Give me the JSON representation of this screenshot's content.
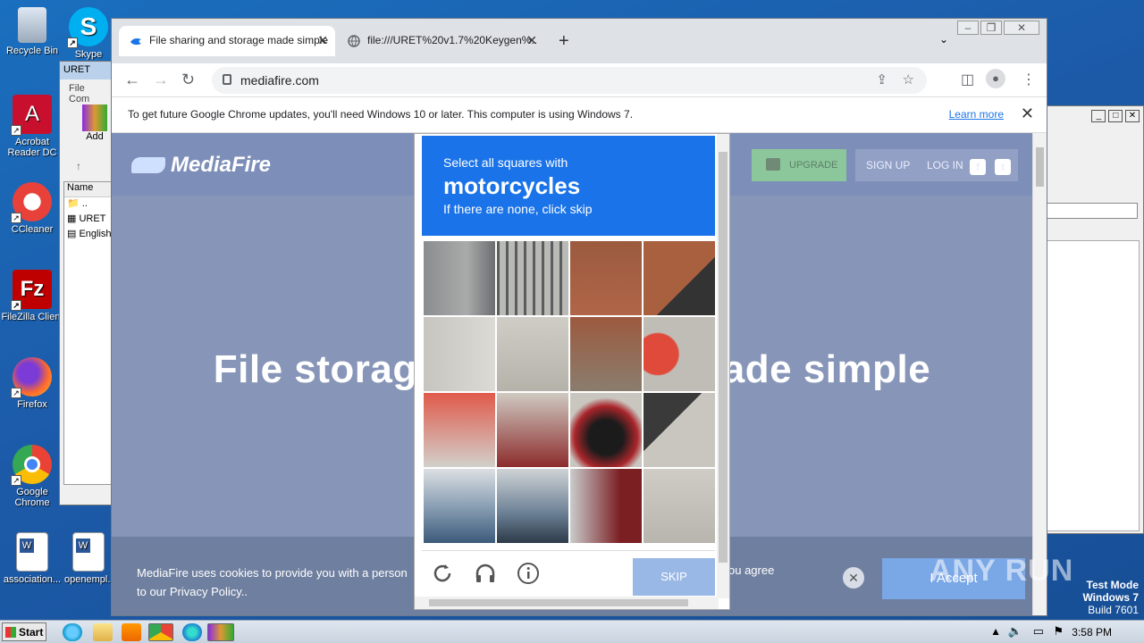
{
  "desktop": {
    "icons": [
      {
        "label": "Recycle Bin"
      },
      {
        "label": "Skype"
      },
      {
        "label": "Acrobat Reader DC"
      },
      {
        "label": "CCleaner"
      },
      {
        "label": "FileZilla Client"
      },
      {
        "label": "Firefox"
      },
      {
        "label": "Google Chrome"
      },
      {
        "label": "association..."
      },
      {
        "label": "openempl..."
      }
    ]
  },
  "winrar": {
    "title": "URET",
    "menu_file": "File",
    "menu_com": "Com",
    "add_label": "Add",
    "col_name": "Name",
    "files": [
      "..",
      "URET",
      "English"
    ]
  },
  "browser": {
    "tabs": [
      {
        "title": "File sharing and storage made simple",
        "active": true
      },
      {
        "title": "file:///URET%20v1.7%20Keygen%..",
        "active": false
      }
    ],
    "url": "mediafire.com",
    "infobar_text": "To get future Google Chrome updates, you'll need Windows 10 or later. This computer is using Windows 7.",
    "infobar_link": "Learn more"
  },
  "mediafire": {
    "logo": "MediaFire",
    "upgrade": "UPGRADE",
    "signup": "SIGN UP",
    "login": "LOG IN",
    "hero_left": "File storag",
    "hero_right": "ade simple",
    "cookie_text": "MediaFire uses cookies to provide you with a person",
    "cookie_text2": "to our Privacy Policy..",
    "cookie_right": "ou agree",
    "accept": "I Accept"
  },
  "captcha": {
    "line1": "Select all squares with",
    "target": "motorcycles",
    "line3": "If there are none, click skip",
    "skip": "SKIP"
  },
  "taskbar": {
    "start": "Start",
    "time": "3:58 PM"
  },
  "watermark": {
    "line1": "Test Mode",
    "line2": "Windows 7",
    "line3": "Build 7601",
    "brand": "ANY RUN"
  },
  "colors": {
    "accent": "#1a73e8",
    "mediafire_bg": "#8796b8"
  }
}
